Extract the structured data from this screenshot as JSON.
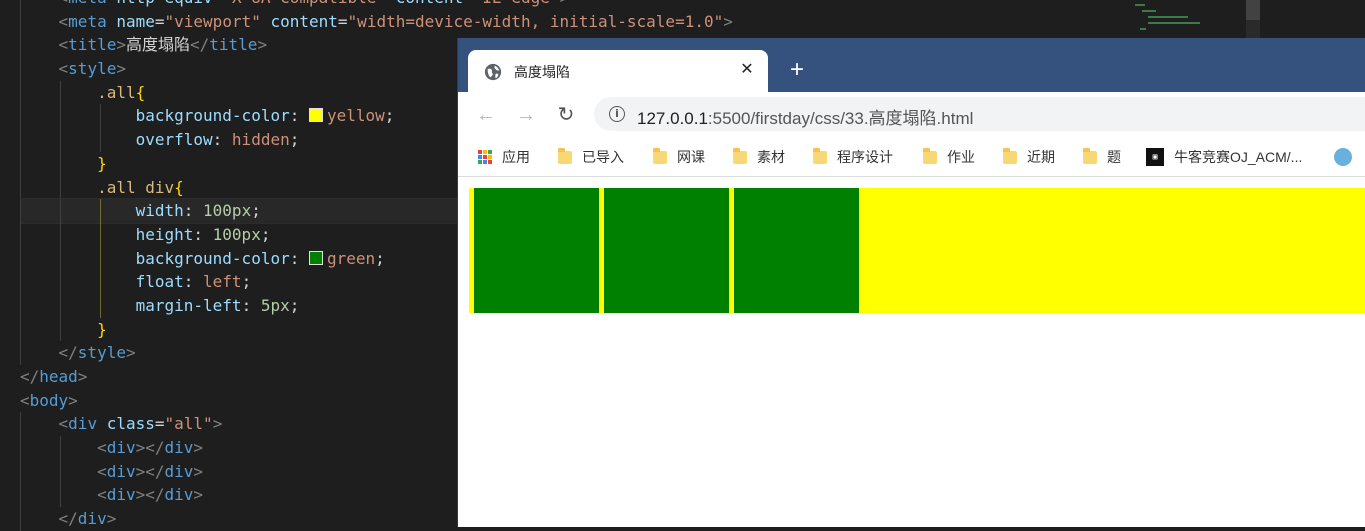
{
  "editor": {
    "lines": [
      [
        [
          "    ",
          "tok-text"
        ],
        [
          "<",
          "tok-punc"
        ],
        [
          "meta",
          "tok-tag"
        ],
        [
          " http-equiv",
          "tok-attr"
        ],
        [
          "=",
          "tok-text"
        ],
        [
          "\"X-UA-Compatible\"",
          "tok-str"
        ],
        [
          " content",
          "tok-attr"
        ],
        [
          "=",
          "tok-text"
        ],
        [
          "\"IE=edge\"",
          "tok-str"
        ],
        [
          ">",
          "tok-punc"
        ]
      ],
      [
        [
          "    ",
          "tok-text"
        ],
        [
          "<",
          "tok-punc"
        ],
        [
          "meta",
          "tok-tag"
        ],
        [
          " name",
          "tok-attr"
        ],
        [
          "=",
          "tok-text"
        ],
        [
          "\"viewport\"",
          "tok-str"
        ],
        [
          " content",
          "tok-attr"
        ],
        [
          "=",
          "tok-text"
        ],
        [
          "\"width=device-width, initial-scale=1.0\"",
          "tok-str"
        ],
        [
          ">",
          "tok-punc"
        ]
      ],
      [
        [
          "    ",
          "tok-text"
        ],
        [
          "<",
          "tok-punc"
        ],
        [
          "title",
          "tok-tag"
        ],
        [
          ">",
          "tok-punc"
        ],
        [
          "高度塌陷",
          "tok-text"
        ],
        [
          "</",
          "tok-punc"
        ],
        [
          "title",
          "tok-tag"
        ],
        [
          ">",
          "tok-punc"
        ]
      ],
      [
        [
          "    ",
          "tok-text"
        ],
        [
          "<",
          "tok-punc"
        ],
        [
          "style",
          "tok-tag"
        ],
        [
          ">",
          "tok-punc"
        ]
      ],
      [
        [
          "        ",
          "tok-text"
        ],
        [
          ".all",
          "tok-sel"
        ],
        [
          "{",
          "tok-brace"
        ]
      ],
      [
        [
          "            ",
          "tok-text"
        ],
        [
          "background-color",
          "tok-prop"
        ],
        [
          ": ",
          "tok-text"
        ],
        [
          "",
          "swatch-yellow"
        ],
        [
          "yellow",
          "tok-val"
        ],
        [
          ";",
          "tok-text"
        ]
      ],
      [
        [
          "            ",
          "tok-text"
        ],
        [
          "overflow",
          "tok-prop"
        ],
        [
          ": ",
          "tok-text"
        ],
        [
          "hidden",
          "tok-val"
        ],
        [
          ";",
          "tok-text"
        ]
      ],
      [
        [
          "        ",
          "tok-text"
        ],
        [
          "}",
          "tok-brace"
        ]
      ],
      [
        [
          "        ",
          "tok-text"
        ],
        [
          ".all div",
          "tok-sel"
        ],
        [
          "{",
          "tok-brace"
        ]
      ],
      [
        [
          "            ",
          "tok-text"
        ],
        [
          "width",
          "tok-prop"
        ],
        [
          ": ",
          "tok-text"
        ],
        [
          "100px",
          "tok-num"
        ],
        [
          ";",
          "tok-text"
        ]
      ],
      [
        [
          "            ",
          "tok-text"
        ],
        [
          "height",
          "tok-prop"
        ],
        [
          ": ",
          "tok-text"
        ],
        [
          "100px",
          "tok-num"
        ],
        [
          ";",
          "tok-text"
        ]
      ],
      [
        [
          "            ",
          "tok-text"
        ],
        [
          "background-color",
          "tok-prop"
        ],
        [
          ": ",
          "tok-text"
        ],
        [
          "",
          "swatch-green"
        ],
        [
          "green",
          "tok-val"
        ],
        [
          ";",
          "tok-text"
        ]
      ],
      [
        [
          "            ",
          "tok-text"
        ],
        [
          "float",
          "tok-prop"
        ],
        [
          ": ",
          "tok-text"
        ],
        [
          "left",
          "tok-val"
        ],
        [
          ";",
          "tok-text"
        ]
      ],
      [
        [
          "            ",
          "tok-text"
        ],
        [
          "margin-left",
          "tok-prop"
        ],
        [
          ": ",
          "tok-text"
        ],
        [
          "5px",
          "tok-num"
        ],
        [
          ";",
          "tok-text"
        ]
      ],
      [
        [
          "        ",
          "tok-text"
        ],
        [
          "}",
          "tok-brace"
        ]
      ],
      [
        [
          "    ",
          "tok-text"
        ],
        [
          "</",
          "tok-punc"
        ],
        [
          "style",
          "tok-tag"
        ],
        [
          ">",
          "tok-punc"
        ]
      ],
      [
        [
          "</",
          "tok-punc"
        ],
        [
          "head",
          "tok-tag"
        ],
        [
          ">",
          "tok-punc"
        ]
      ],
      [
        [
          "<",
          "tok-punc"
        ],
        [
          "body",
          "tok-tag"
        ],
        [
          ">",
          "tok-punc"
        ]
      ],
      [
        [
          "    ",
          "tok-text"
        ],
        [
          "<",
          "tok-punc"
        ],
        [
          "div",
          "tok-tag"
        ],
        [
          " class",
          "tok-attr"
        ],
        [
          "=",
          "tok-text"
        ],
        [
          "\"all\"",
          "tok-str"
        ],
        [
          ">",
          "tok-punc"
        ]
      ],
      [
        [
          "        ",
          "tok-text"
        ],
        [
          "<",
          "tok-punc"
        ],
        [
          "div",
          "tok-tag"
        ],
        [
          "></",
          "tok-punc"
        ],
        [
          "div",
          "tok-tag"
        ],
        [
          ">",
          "tok-punc"
        ]
      ],
      [
        [
          "        ",
          "tok-text"
        ],
        [
          "<",
          "tok-punc"
        ],
        [
          "div",
          "tok-tag"
        ],
        [
          "></",
          "tok-punc"
        ],
        [
          "div",
          "tok-tag"
        ],
        [
          ">",
          "tok-punc"
        ]
      ],
      [
        [
          "        ",
          "tok-text"
        ],
        [
          "<",
          "tok-punc"
        ],
        [
          "div",
          "tok-tag"
        ],
        [
          "></",
          "tok-punc"
        ],
        [
          "div",
          "tok-tag"
        ],
        [
          ">",
          "tok-punc"
        ]
      ],
      [
        [
          "    ",
          "tok-text"
        ],
        [
          "</",
          "tok-punc"
        ],
        [
          "div",
          "tok-tag"
        ],
        [
          ">",
          "tok-punc"
        ]
      ]
    ],
    "active_line": 9,
    "swatch_colors": {
      "yellow": "#ffff00",
      "green": "#008000"
    }
  },
  "browser": {
    "tab": {
      "title": "高度塌陷",
      "icon": "globe-icon",
      "close": "✕"
    },
    "new_tab": "+",
    "nav": {
      "back": "←",
      "forward": "→",
      "reload": "↻"
    },
    "url": {
      "host": "127.0.0.1",
      "rest": ":5500/firstday/css/33.高度塌陷.html"
    },
    "bookmarks": [
      {
        "label": "应用",
        "icon": "apps-icon"
      },
      {
        "label": "已导入",
        "icon": "folder-icon"
      },
      {
        "label": "网课",
        "icon": "folder-icon"
      },
      {
        "label": "素材",
        "icon": "folder-icon"
      },
      {
        "label": "程序设计",
        "icon": "folder-icon"
      },
      {
        "label": "作业",
        "icon": "folder-icon"
      },
      {
        "label": "近期",
        "icon": "folder-icon"
      },
      {
        "label": "题",
        "icon": "folder-icon"
      },
      {
        "label": "牛客竞赛OJ_ACM/...",
        "icon": "nowcoder-icon"
      },
      {
        "label": "",
        "icon": "globe-bookmark-icon"
      }
    ],
    "colors": {
      "tabstrip": "#35527f",
      "container": "#ffff00",
      "box": "#008000"
    }
  }
}
